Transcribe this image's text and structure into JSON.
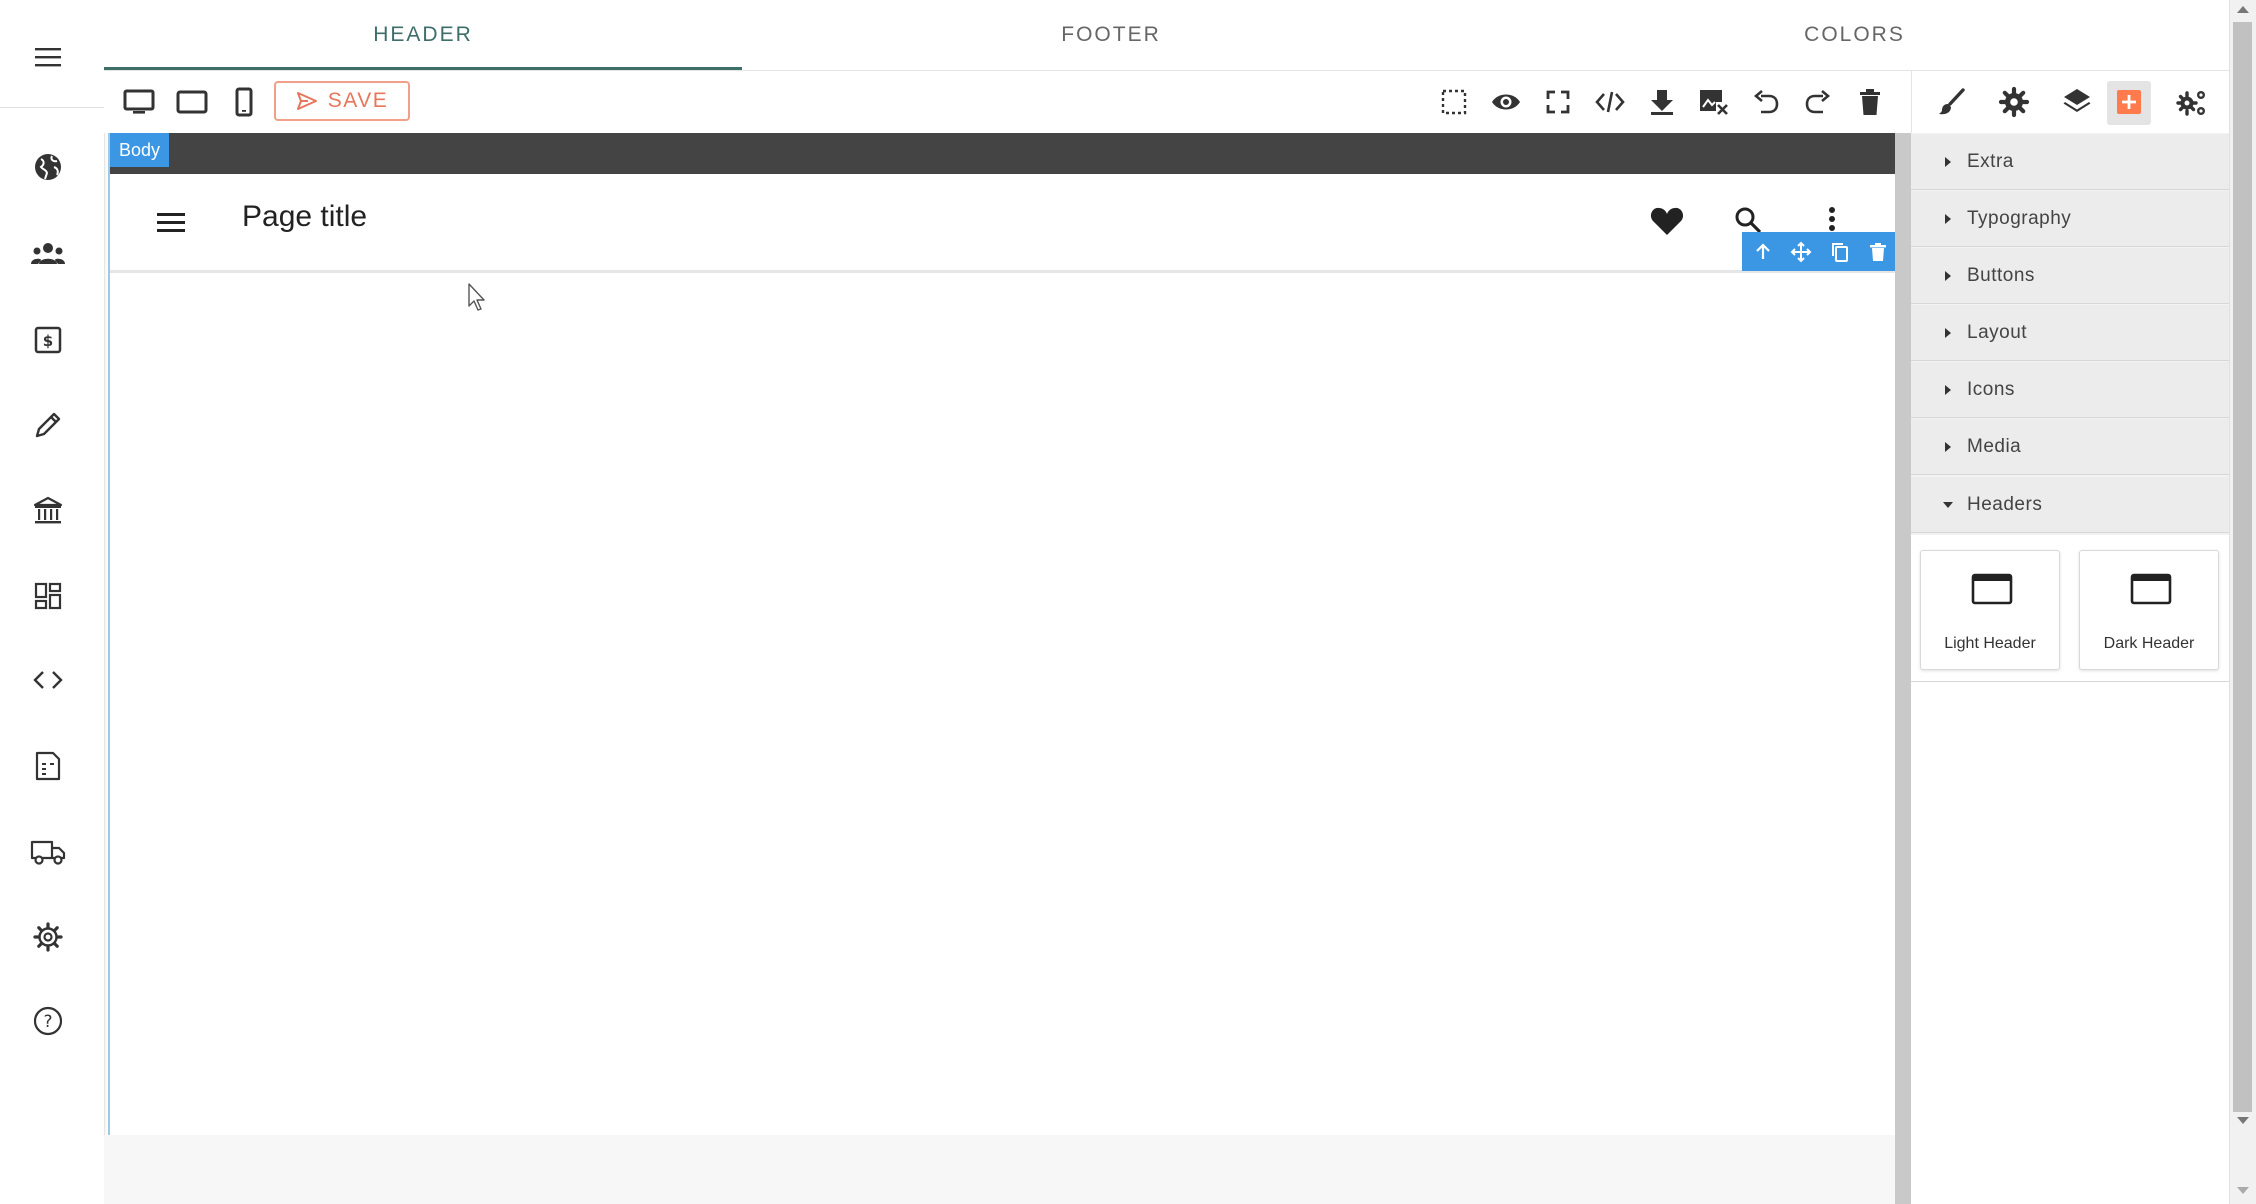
{
  "tabs": [
    {
      "label": "HEADER",
      "active": true
    },
    {
      "label": "FOOTER",
      "active": false
    },
    {
      "label": "COLORS",
      "active": false
    }
  ],
  "toolbar": {
    "save_label": "SAVE",
    "devices": [
      "desktop-icon",
      "tablet-icon",
      "mobile-icon"
    ],
    "actions": [
      "select-outline-icon",
      "eye-icon",
      "fullscreen-icon",
      "code-icon",
      "download-icon",
      "image-remove-icon",
      "undo-icon",
      "redo-icon",
      "trash-icon"
    ]
  },
  "panel_toolbar": {
    "icons": [
      "brush-icon",
      "gear-icon",
      "layers-icon",
      "add-block-icon",
      "settings-cogs-icon"
    ],
    "active": "add-block-icon"
  },
  "canvas": {
    "body_badge": "Body",
    "header": {
      "page_title": "Page title"
    }
  },
  "categories": [
    {
      "label": "Extra",
      "open": false
    },
    {
      "label": "Typography",
      "open": false
    },
    {
      "label": "Buttons",
      "open": false
    },
    {
      "label": "Layout",
      "open": false
    },
    {
      "label": "Icons",
      "open": false
    },
    {
      "label": "Media",
      "open": false
    },
    {
      "label": "Headers",
      "open": true
    }
  ],
  "header_blocks": [
    {
      "label": "Light Header"
    },
    {
      "label": "Dark Header"
    }
  ],
  "left_rail": [
    "menu-icon",
    "globe-icon",
    "users-icon",
    "billing-icon",
    "pencil-icon",
    "bank-icon",
    "dashboard-icon",
    "code-brackets-icon",
    "document-icon",
    "truck-icon",
    "gear-icon",
    "help-icon"
  ],
  "colors": {
    "accent": "#3d6e6a",
    "save": "#e8765a",
    "selection": "#3b97e3",
    "canvas_topbar": "#444444"
  }
}
